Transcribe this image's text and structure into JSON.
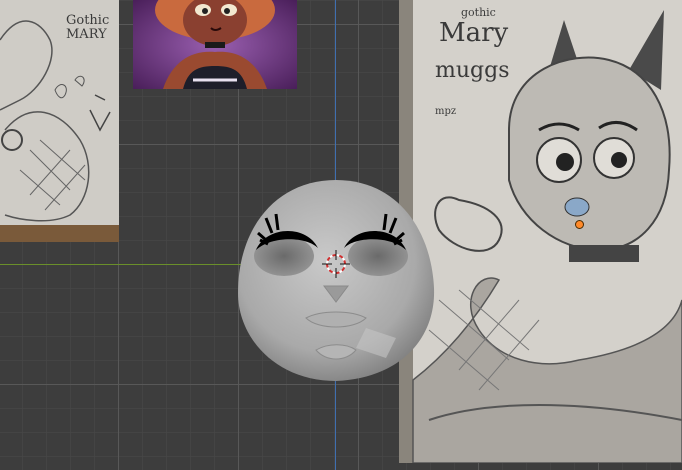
{
  "viewport": {
    "grid_color": "#5a5a5a",
    "background_color": "#3d3d3d",
    "axis_x_color": "#6a8f2a",
    "axis_z_color": "#3f6fb0"
  },
  "references": {
    "left": {
      "text": "Gothic MARY"
    },
    "top": {
      "accent_color": "#5e2b6b"
    },
    "right": {
      "text_lines": [
        "gothic",
        "Mary",
        "muggs",
        "mpz"
      ]
    }
  },
  "head": {
    "color": "#b7b7b7",
    "eyelash_color": "#000000"
  },
  "selection": {
    "vertex_color": "#ff8a2a"
  }
}
